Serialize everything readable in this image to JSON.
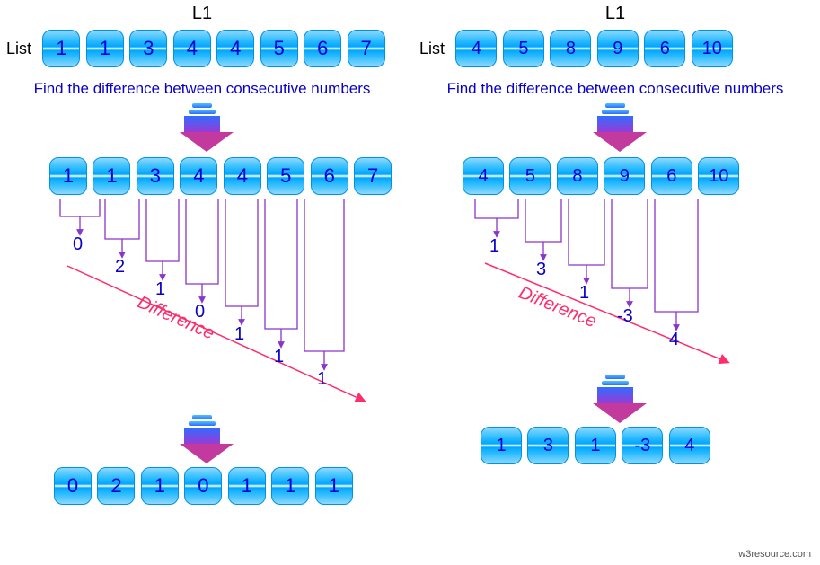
{
  "watermark": "w3resource.com",
  "left": {
    "title": "L1",
    "list_label": "List",
    "subtitle": "Find the difference between consecutive numbers",
    "values": [
      "1",
      "1",
      "3",
      "4",
      "4",
      "5",
      "6",
      "7"
    ],
    "diffs": [
      "0",
      "2",
      "1",
      "0",
      "1",
      "1",
      "1"
    ],
    "diff_word": "Difference",
    "result": [
      "0",
      "2",
      "1",
      "0",
      "1",
      "1",
      "1"
    ]
  },
  "right": {
    "title": "L1",
    "list_label": "List",
    "subtitle": "Find the difference between consecutive numbers",
    "values": [
      "4",
      "5",
      "8",
      "9",
      "6",
      "10"
    ],
    "diffs": [
      "1",
      "3",
      "1",
      "-3",
      "4"
    ],
    "diff_word": "Difference",
    "result": [
      "1",
      "3",
      "1",
      "-3",
      "4"
    ]
  }
}
